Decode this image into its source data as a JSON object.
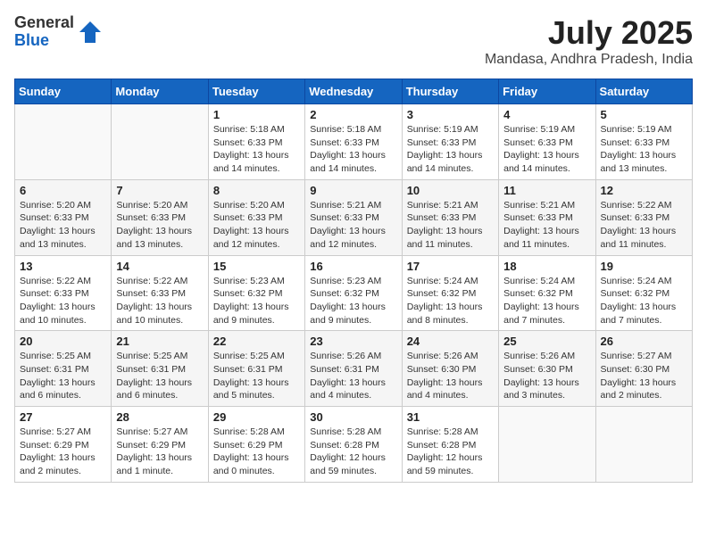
{
  "header": {
    "logo_general": "General",
    "logo_blue": "Blue",
    "month_year": "July 2025",
    "location": "Mandasa, Andhra Pradesh, India"
  },
  "weekdays": [
    "Sunday",
    "Monday",
    "Tuesday",
    "Wednesday",
    "Thursday",
    "Friday",
    "Saturday"
  ],
  "weeks": [
    [
      {
        "day": "",
        "info": ""
      },
      {
        "day": "",
        "info": ""
      },
      {
        "day": "1",
        "info": "Sunrise: 5:18 AM\nSunset: 6:33 PM\nDaylight: 13 hours and 14 minutes."
      },
      {
        "day": "2",
        "info": "Sunrise: 5:18 AM\nSunset: 6:33 PM\nDaylight: 13 hours and 14 minutes."
      },
      {
        "day": "3",
        "info": "Sunrise: 5:19 AM\nSunset: 6:33 PM\nDaylight: 13 hours and 14 minutes."
      },
      {
        "day": "4",
        "info": "Sunrise: 5:19 AM\nSunset: 6:33 PM\nDaylight: 13 hours and 14 minutes."
      },
      {
        "day": "5",
        "info": "Sunrise: 5:19 AM\nSunset: 6:33 PM\nDaylight: 13 hours and 13 minutes."
      }
    ],
    [
      {
        "day": "6",
        "info": "Sunrise: 5:20 AM\nSunset: 6:33 PM\nDaylight: 13 hours and 13 minutes."
      },
      {
        "day": "7",
        "info": "Sunrise: 5:20 AM\nSunset: 6:33 PM\nDaylight: 13 hours and 13 minutes."
      },
      {
        "day": "8",
        "info": "Sunrise: 5:20 AM\nSunset: 6:33 PM\nDaylight: 13 hours and 12 minutes."
      },
      {
        "day": "9",
        "info": "Sunrise: 5:21 AM\nSunset: 6:33 PM\nDaylight: 13 hours and 12 minutes."
      },
      {
        "day": "10",
        "info": "Sunrise: 5:21 AM\nSunset: 6:33 PM\nDaylight: 13 hours and 11 minutes."
      },
      {
        "day": "11",
        "info": "Sunrise: 5:21 AM\nSunset: 6:33 PM\nDaylight: 13 hours and 11 minutes."
      },
      {
        "day": "12",
        "info": "Sunrise: 5:22 AM\nSunset: 6:33 PM\nDaylight: 13 hours and 11 minutes."
      }
    ],
    [
      {
        "day": "13",
        "info": "Sunrise: 5:22 AM\nSunset: 6:33 PM\nDaylight: 13 hours and 10 minutes."
      },
      {
        "day": "14",
        "info": "Sunrise: 5:22 AM\nSunset: 6:33 PM\nDaylight: 13 hours and 10 minutes."
      },
      {
        "day": "15",
        "info": "Sunrise: 5:23 AM\nSunset: 6:32 PM\nDaylight: 13 hours and 9 minutes."
      },
      {
        "day": "16",
        "info": "Sunrise: 5:23 AM\nSunset: 6:32 PM\nDaylight: 13 hours and 9 minutes."
      },
      {
        "day": "17",
        "info": "Sunrise: 5:24 AM\nSunset: 6:32 PM\nDaylight: 13 hours and 8 minutes."
      },
      {
        "day": "18",
        "info": "Sunrise: 5:24 AM\nSunset: 6:32 PM\nDaylight: 13 hours and 7 minutes."
      },
      {
        "day": "19",
        "info": "Sunrise: 5:24 AM\nSunset: 6:32 PM\nDaylight: 13 hours and 7 minutes."
      }
    ],
    [
      {
        "day": "20",
        "info": "Sunrise: 5:25 AM\nSunset: 6:31 PM\nDaylight: 13 hours and 6 minutes."
      },
      {
        "day": "21",
        "info": "Sunrise: 5:25 AM\nSunset: 6:31 PM\nDaylight: 13 hours and 6 minutes."
      },
      {
        "day": "22",
        "info": "Sunrise: 5:25 AM\nSunset: 6:31 PM\nDaylight: 13 hours and 5 minutes."
      },
      {
        "day": "23",
        "info": "Sunrise: 5:26 AM\nSunset: 6:31 PM\nDaylight: 13 hours and 4 minutes."
      },
      {
        "day": "24",
        "info": "Sunrise: 5:26 AM\nSunset: 6:30 PM\nDaylight: 13 hours and 4 minutes."
      },
      {
        "day": "25",
        "info": "Sunrise: 5:26 AM\nSunset: 6:30 PM\nDaylight: 13 hours and 3 minutes."
      },
      {
        "day": "26",
        "info": "Sunrise: 5:27 AM\nSunset: 6:30 PM\nDaylight: 13 hours and 2 minutes."
      }
    ],
    [
      {
        "day": "27",
        "info": "Sunrise: 5:27 AM\nSunset: 6:29 PM\nDaylight: 13 hours and 2 minutes."
      },
      {
        "day": "28",
        "info": "Sunrise: 5:27 AM\nSunset: 6:29 PM\nDaylight: 13 hours and 1 minute."
      },
      {
        "day": "29",
        "info": "Sunrise: 5:28 AM\nSunset: 6:29 PM\nDaylight: 13 hours and 0 minutes."
      },
      {
        "day": "30",
        "info": "Sunrise: 5:28 AM\nSunset: 6:28 PM\nDaylight: 12 hours and 59 minutes."
      },
      {
        "day": "31",
        "info": "Sunrise: 5:28 AM\nSunset: 6:28 PM\nDaylight: 12 hours and 59 minutes."
      },
      {
        "day": "",
        "info": ""
      },
      {
        "day": "",
        "info": ""
      }
    ]
  ]
}
